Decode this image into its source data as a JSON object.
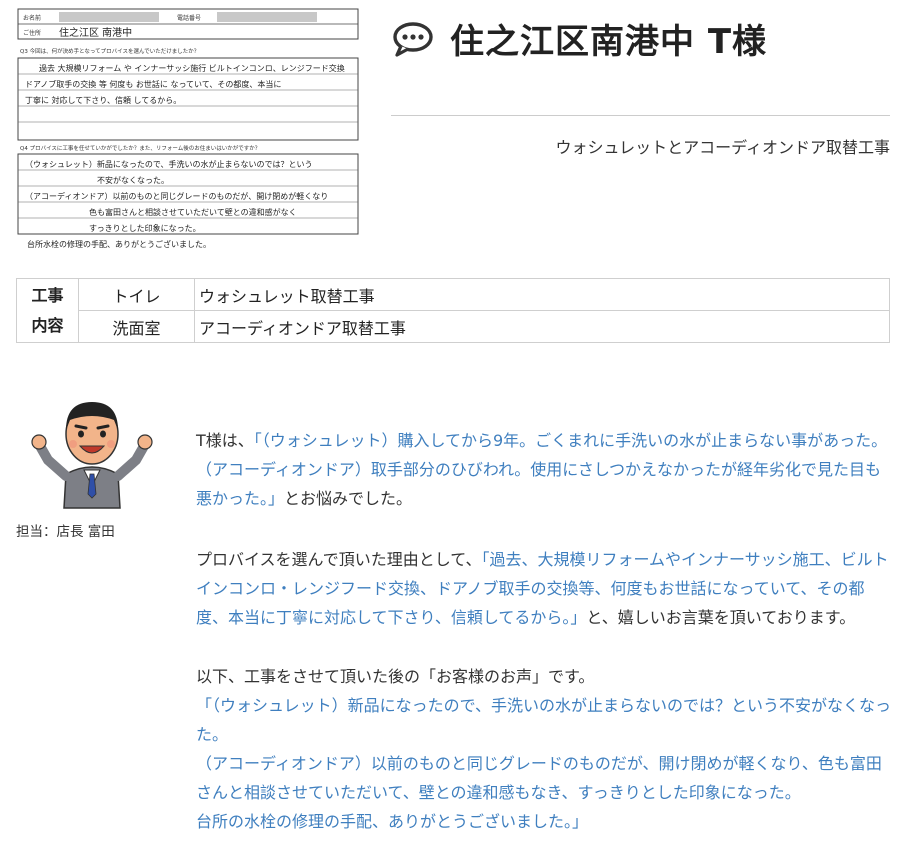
{
  "survey_form": {
    "name_label": "お名前",
    "address_label": "ご住所",
    "address_value": "住之江区 南港中",
    "q3_label": "Q3 今回は、何が決め手となってプロバイスを選んでいただけましたか？",
    "q3_lines": [
      "過去 大規模リフォーム や インナーサッシ施行 ビルトインコンロ、レンジフード交換",
      "ドアノブ取手の交換 等 何度も お世話に なっていて、その都度、本当に",
      "丁寧に 対応して下さり、信頼 してるから。"
    ],
    "q4_label": "Q4 プロバイスに工事を任せていかがでしたか？また、リフォーム後のお住まいはいかがですか？",
    "q4_lines": [
      "（ウォシュレット）新品になったので、手洗いの水が止まらないのでは？という",
      "不安がなくなった。",
      "（アコーディオンドア）以前のものと同じグレードのものだが、開け閉めが軽くなり",
      "色も富田さんと相談させていただいて壁との違和感がなく",
      "すっきりとした印象になった。",
      "台所水栓の修理の手配、ありがとうございました。"
    ]
  },
  "header": {
    "icon": "speech-bubble-icon",
    "title": "住之江区南港中 T様",
    "subtitle": "ウォシュレットとアコーディオンドア取替工事"
  },
  "work_table": {
    "header_line1": "工事",
    "header_line2": "内容",
    "rows": [
      {
        "room": "トイレ",
        "job": "ウォシュレット取替工事"
      },
      {
        "room": "洗面室",
        "job": "アコーディオンドア取替工事"
      }
    ]
  },
  "staff": {
    "caption": "担当：店長 富田"
  },
  "body": {
    "p1_a": "T様は、",
    "p1_quote": "「（ウォシュレット）購入してから9年。ごくまれに手洗いの水が止まらない事があった。（アコーディオンドア）取手部分のひびわれ。使用にさしつかえなかったが経年劣化で見た目も悪かった。」",
    "p1_b": "とお悩みでした。",
    "p2_a": "プロバイスを選んで頂いた理由として、",
    "p2_quote": "「過去、大規模リフォームやインナーサッシ施工、ビルトインコンロ・レンジフード交換、ドアノブ取手の交換等、何度もお世話になっていて、その都度、本当に丁寧に対応して下さり、信頼してるから。」",
    "p2_b": "と、嬉しいお言葉を頂いております。",
    "p3_intro": "以下、工事をさせて頂いた後の「お客様のお声」です。",
    "p3_line1": "「（ウォシュレット）新品になったので、手洗いの水が止まらないのでは？という不安がなくなった。",
    "p3_line2": "（アコーディオンドア）以前のものと同じグレードのものだが、開け閉めが軽くなり、色も富田さんと相談させていただいて、壁との違和感もなき、すっきりとした印象になった。",
    "p3_line3": "台所の水栓の修理の手配、ありがとうございました。」"
  },
  "colors": {
    "accent_blue": "#3f7fbf",
    "text": "#333333",
    "border": "#cfcfcf"
  }
}
